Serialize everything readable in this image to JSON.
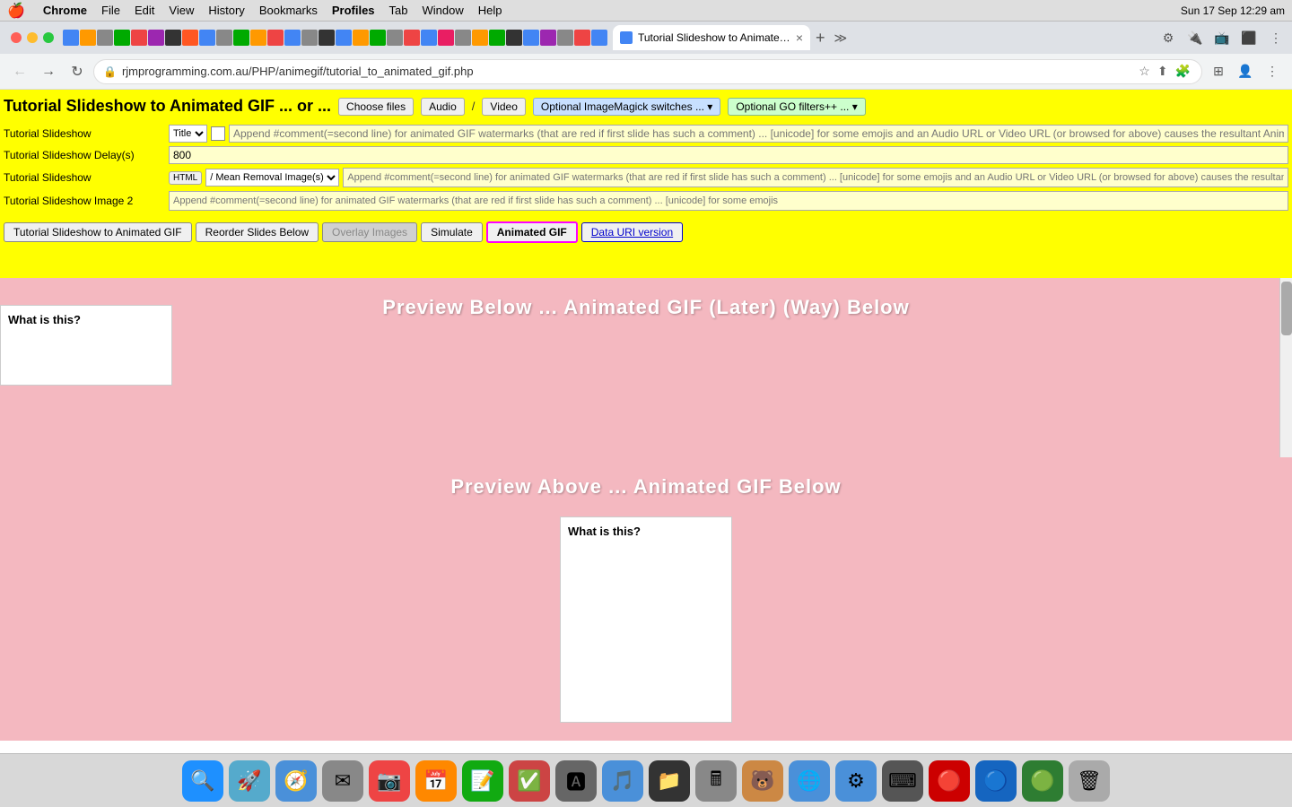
{
  "menubar": {
    "apple": "🍎",
    "app": "Chrome",
    "items": [
      "File",
      "Edit",
      "View",
      "History",
      "Bookmarks",
      "Profiles",
      "Tab",
      "Window",
      "Help"
    ],
    "time": "Sun 17 Sep  12:29 am"
  },
  "tab": {
    "title": "Tutorial Slideshow to Animated GIF ...",
    "favicon_color": "#4285f4"
  },
  "navbar": {
    "url": "rjmprogramming.com.au/PHP/animegif/tutorial_to_animated_gif.php",
    "scheme": "https"
  },
  "page": {
    "title": "Tutorial Slideshow to Animated GIF ... or ...",
    "choose_files_label": "Choose files",
    "audio_label": "Audio",
    "separator": "/",
    "video_label": "Video",
    "imagemagick_label": "Optional ImageMagick switches ... ▾",
    "go_filters_label": "Optional GO filters++ ... ▾",
    "form": {
      "slideshow_label": "Tutorial Slideshow",
      "slideshow_select_value": "Title",
      "delay_label": "Tutorial Slideshow Delay(s)",
      "delay_value": "800",
      "html_label": "Tutorial Slideshow",
      "html_btn": "HTML",
      "mean_select": "/ Mean Removal Image(s)",
      "img_placeholder": "Append #comment(=second line) for animated GIF watermarks (that are red if first slide has such a comment) ... [unicode] for some emojis and an Audio URL or Video URL (or browsed for above) causes the resultant Animated GIF to be its background image",
      "img2_label": "Tutorial Slideshow Image 2",
      "img2_placeholder": "Append #comment(=second line) for animated GIF watermarks (that are red if first slide has such a comment) ... [unicode] for some emojis"
    },
    "buttons": {
      "slideshow_to_gif": "Tutorial Slideshow to Animated GIF",
      "reorder_slides": "Reorder Slides Below",
      "overlay_images": "Overlay Images",
      "simulate": "Simulate",
      "animated_gif": "Animated GIF",
      "data_uri": "Data URI version"
    },
    "preview_above_title": "Preview Below ... Animated GIF (Later) (Way) Below",
    "preview_below_title": "Preview Above ... Animated GIF Below",
    "preview_box_text": "What is this?",
    "animated_gif_box_text": "What is this?"
  }
}
